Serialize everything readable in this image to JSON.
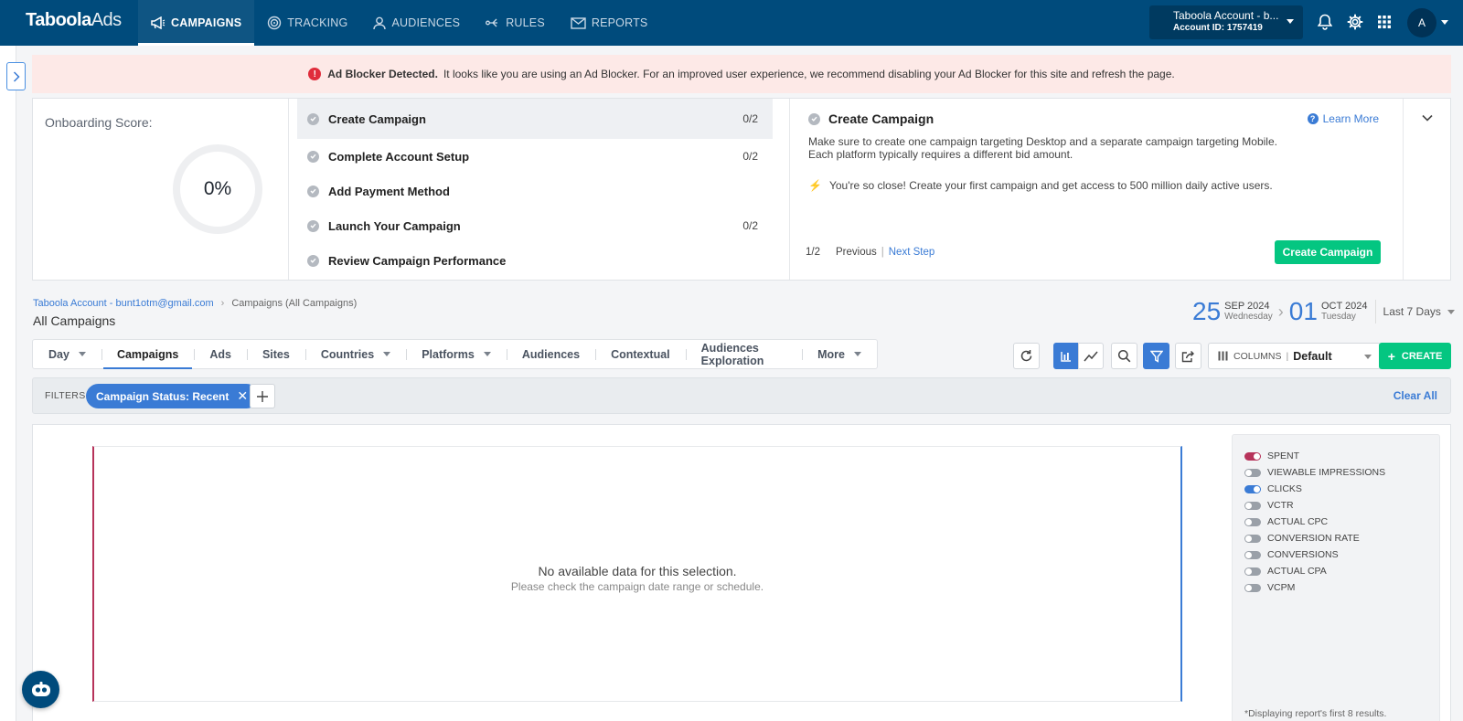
{
  "brand": {
    "logo_bold": "Taboola",
    "logo_light": "Ads"
  },
  "nav": {
    "items": [
      {
        "label": "CAMPAIGNS",
        "icon": "megaphone-icon",
        "active": true
      },
      {
        "label": "TRACKING",
        "icon": "tracking-icon"
      },
      {
        "label": "AUDIENCES",
        "icon": "person-icon"
      },
      {
        "label": "RULES",
        "icon": "rules-icon"
      },
      {
        "label": "REPORTS",
        "icon": "envelope-icon"
      }
    ]
  },
  "account": {
    "name": "Taboola Account - b...",
    "id_text": "Account ID: 1757419",
    "avatar_initial": "A"
  },
  "banner": {
    "title": "Ad Blocker Detected.",
    "message": "It looks like you are using an Ad Blocker. For an improved user experience, we recommend disabling your Ad Blocker for this site and refresh the page."
  },
  "onboarding": {
    "score_label": "Onboarding Score:",
    "score_value": "0%",
    "steps": [
      {
        "label": "Create Campaign",
        "count": "0/2"
      },
      {
        "label": "Complete Account Setup",
        "count": "0/2"
      },
      {
        "label": "Add Payment Method",
        "count": ""
      },
      {
        "label": "Launch Your Campaign",
        "count": "0/2"
      },
      {
        "label": "Review Campaign Performance",
        "count": ""
      }
    ],
    "detail": {
      "title": "Create Campaign",
      "learn_more": "Learn More",
      "description": "Make sure to create one campaign targeting Desktop and a separate campaign targeting Mobile. Each platform typically requires a different bid amount.",
      "tip": "You're so close! Create your first campaign and get access to 500 million daily active users.",
      "pager": "1/2",
      "previous": "Previous",
      "next": "Next Step",
      "cta": "Create Campaign"
    }
  },
  "breadcrumb": {
    "account": "Taboola Account - bunt1otm@gmail.com",
    "current": "Campaigns (All Campaigns)"
  },
  "page_title": "All Campaigns",
  "date_range": {
    "start_day": "25",
    "start_month": "SEP 2024",
    "start_weekday": "Wednesday",
    "end_day": "01",
    "end_month": "OCT 2024",
    "end_weekday": "Tuesday",
    "preset": "Last 7 Days"
  },
  "dimension_tabs": [
    {
      "label": "Day",
      "dropdown": true
    },
    {
      "label": "Campaigns",
      "active": true
    },
    {
      "label": "Ads"
    },
    {
      "label": "Sites"
    },
    {
      "label": "Countries",
      "dropdown": true
    },
    {
      "label": "Platforms",
      "dropdown": true
    },
    {
      "label": "Audiences"
    },
    {
      "label": "Contextual"
    },
    {
      "label": "Audiences Exploration"
    },
    {
      "label": "More",
      "dropdown": true
    }
  ],
  "toolbar": {
    "columns_label": "COLUMNS",
    "columns_value": "Default",
    "create_label": "CREATE"
  },
  "filters": {
    "label": "FILTERS",
    "chip": "Campaign Status: Recent",
    "clear_all": "Clear All"
  },
  "chart": {
    "no_data_title": "No available data for this selection.",
    "no_data_hint": "Please check the campaign date range or schedule.",
    "metrics": [
      {
        "label": "SPENT",
        "on": true,
        "color": "#b7335a"
      },
      {
        "label": "VIEWABLE IMPRESSIONS",
        "on": false
      },
      {
        "label": "CLICKS",
        "on": true,
        "color": "#3a7bd5"
      },
      {
        "label": "VCTR",
        "on": false
      },
      {
        "label": "ACTUAL CPC",
        "on": false
      },
      {
        "label": "CONVERSION RATE",
        "on": false
      },
      {
        "label": "CONVERSIONS",
        "on": false
      },
      {
        "label": "ACTUAL CPA",
        "on": false
      },
      {
        "label": "VCPM",
        "on": false
      }
    ],
    "footnote": "*Displaying report's first 8 results."
  },
  "colors": {
    "nav_bg": "#004b7c",
    "accent": "#3a7bd5",
    "cta": "#04c681",
    "banner_bg": "#fde9e7",
    "warning": "#e02d3c"
  }
}
